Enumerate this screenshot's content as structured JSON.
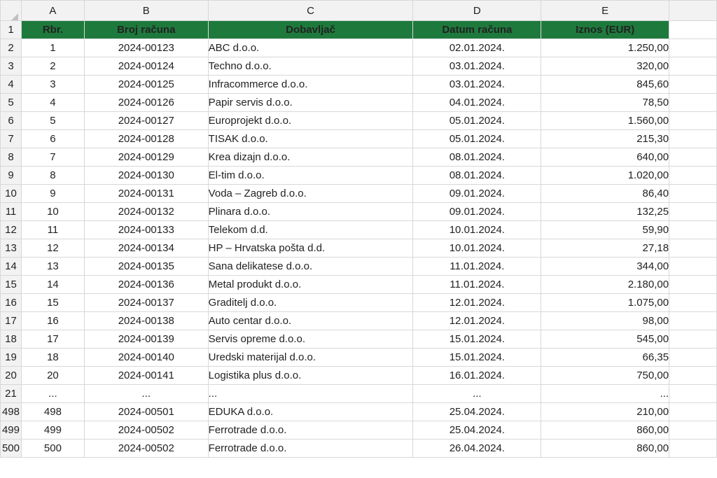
{
  "columns": [
    "A",
    "B",
    "C",
    "D",
    "E"
  ],
  "header_row_number": "1",
  "header": [
    "Rbr.",
    "Broj računa",
    "Dobavljač",
    "Datum računa",
    "Iznos (EUR)"
  ],
  "rows": [
    {
      "n": "2",
      "cells": [
        "1",
        "2024-00123",
        "ABC d.o.o.",
        "02.01.2024.",
        "1.250,00"
      ]
    },
    {
      "n": "3",
      "cells": [
        "2",
        "2024-00124",
        "Techno d.o.o.",
        "03.01.2024.",
        "320,00"
      ]
    },
    {
      "n": "4",
      "cells": [
        "3",
        "2024-00125",
        "Infracommerce d.o.o.",
        "03.01.2024.",
        "845,60"
      ]
    },
    {
      "n": "5",
      "cells": [
        "4",
        "2024-00126",
        "Papir servis d.o.o.",
        "04.01.2024.",
        "78,50"
      ]
    },
    {
      "n": "6",
      "cells": [
        "5",
        "2024-00127",
        "Europrojekt d.o.o.",
        "05.01.2024.",
        "1.560,00"
      ]
    },
    {
      "n": "7",
      "cells": [
        "6",
        "2024-00128",
        "TISAK d.o.o.",
        "05.01.2024.",
        "215,30"
      ]
    },
    {
      "n": "8",
      "cells": [
        "7",
        "2024-00129",
        "Krea dizajn d.o.o.",
        "08.01.2024.",
        "640,00"
      ]
    },
    {
      "n": "9",
      "cells": [
        "8",
        "2024-00130",
        "El-tim d.o.o.",
        "08.01.2024.",
        "1.020,00"
      ]
    },
    {
      "n": "10",
      "cells": [
        "9",
        "2024-00131",
        "Voda – Zagreb d.o.o.",
        "09.01.2024.",
        "86,40"
      ]
    },
    {
      "n": "11",
      "cells": [
        "10",
        "2024-00132",
        "Plinara d.o.o.",
        "09.01.2024.",
        "132,25"
      ]
    },
    {
      "n": "12",
      "cells": [
        "11",
        "2024-00133",
        "Telekom d.d.",
        "10.01.2024.",
        "59,90"
      ]
    },
    {
      "n": "13",
      "cells": [
        "12",
        "2024-00134",
        "HP – Hrvatska pošta d.d.",
        "10.01.2024.",
        "27,18"
      ]
    },
    {
      "n": "14",
      "cells": [
        "13",
        "2024-00135",
        "Sana delikatese d.o.o.",
        "11.01.2024.",
        "344,00"
      ]
    },
    {
      "n": "15",
      "cells": [
        "14",
        "2024-00136",
        "Metal produkt d.o.o.",
        "11.01.2024.",
        "2.180,00"
      ]
    },
    {
      "n": "16",
      "cells": [
        "15",
        "2024-00137",
        "Graditelj d.o.o.",
        "12.01.2024.",
        "1.075,00"
      ]
    },
    {
      "n": "17",
      "cells": [
        "16",
        "2024-00138",
        "Auto centar d.o.o.",
        "12.01.2024.",
        "98,00"
      ]
    },
    {
      "n": "18",
      "cells": [
        "17",
        "2024-00139",
        "Servis opreme d.o.o.",
        "15.01.2024.",
        "545,00"
      ]
    },
    {
      "n": "19",
      "cells": [
        "18",
        "2024-00140",
        "Uredski materijal d.o.o.",
        "15.01.2024.",
        "66,35"
      ]
    },
    {
      "n": "20",
      "cells": [
        "20",
        "2024-00141",
        "Logistika plus d.o.o.",
        "16.01.2024.",
        "750,00"
      ]
    },
    {
      "n": "21",
      "cells": [
        "...",
        "...",
        "...",
        "...",
        "..."
      ]
    },
    {
      "n": "498",
      "cells": [
        "498",
        "2024-00501",
        "EDUKA d.o.o.",
        "25.04.2024.",
        "210,00"
      ]
    },
    {
      "n": "499",
      "cells": [
        "499",
        "2024-00502",
        "Ferrotrade d.o.o.",
        "25.04.2024.",
        "860,00"
      ]
    },
    {
      "n": "500",
      "cells": [
        "500",
        "2024-00502",
        "Ferrotrade d.o.o.",
        "26.04.2024.",
        "860,00"
      ]
    }
  ],
  "colors": {
    "header_green": "#1e7a3c",
    "header_text": "#ffffff",
    "gridline": "#d8d8d8",
    "sheet_header_bg": "#f2f2f2"
  }
}
